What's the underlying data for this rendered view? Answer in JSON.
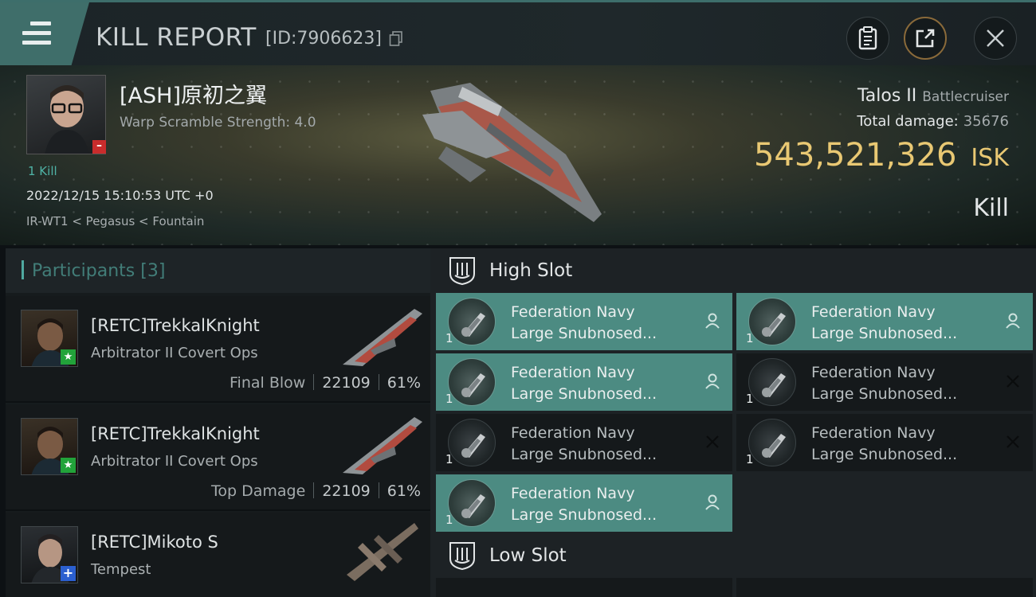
{
  "header": {
    "title": "KILL REPORT",
    "kill_id": "[ID:7906623]",
    "icons": [
      "menu-icon",
      "copy-icon",
      "clipboard-icon",
      "share-icon",
      "close-icon"
    ]
  },
  "victim": {
    "name": "[ASH]原初之翼",
    "warp_scramble": "Warp Scramble Strength: 4.0",
    "kill_count": "1 Kill",
    "datetime": "2022/12/15 15:10:53 UTC +0",
    "location": "IR-WT1 < Pegasus < Fountain",
    "ship_name": "Talos II",
    "ship_class": "Battlecruiser",
    "total_damage_label": "Total damage:",
    "total_damage": "35676",
    "isk_value": "543,521,326",
    "isk_unit": "ISK",
    "result": "Kill"
  },
  "participants": {
    "label": "Participants",
    "count": "[3]",
    "rows": [
      {
        "name": "[RETC]TrekkalKnight",
        "ship": "Arbitrator II Covert Ops",
        "tag": "Final Blow",
        "damage": "22109",
        "percent": "61%"
      },
      {
        "name": "[RETC]TrekkalKnight",
        "ship": "Arbitrator II Covert Ops",
        "tag": "Top Damage",
        "damage": "22109",
        "percent": "61%"
      },
      {
        "name": "[RETC]Mikoto S",
        "ship": "Tempest"
      }
    ]
  },
  "slots": {
    "high": {
      "label": "High Slot",
      "modules": [
        {
          "qty": "1",
          "line1": "Federation Navy",
          "line2": "Large Snubnosed...",
          "state": "fitted"
        },
        {
          "qty": "1",
          "line1": "Federation Navy",
          "line2": "Large Snubnosed...",
          "state": "fitted"
        },
        {
          "qty": "1",
          "line1": "Federation Navy",
          "line2": "Large Snubnosed...",
          "state": "fitted"
        },
        {
          "qty": "1",
          "line1": "Federation Navy",
          "line2": "Large Snubnosed...",
          "state": "destroyed"
        },
        {
          "qty": "1",
          "line1": "Federation Navy",
          "line2": "Large Snubnosed...",
          "state": "destroyed"
        },
        {
          "qty": "1",
          "line1": "Federation Navy",
          "line2": "Large Snubnosed...",
          "state": "destroyed"
        },
        {
          "qty": "1",
          "line1": "Federation Navy",
          "line2": "Large Snubnosed...",
          "state": "fitted"
        }
      ]
    },
    "low": {
      "label": "Low Slot"
    }
  },
  "colors": {
    "accent_teal": "#4c8b82",
    "isk_gold": "#e9c873",
    "badge_red": "#c92c2c",
    "badge_green": "#22a33a",
    "badge_blue": "#2b5fcf"
  }
}
